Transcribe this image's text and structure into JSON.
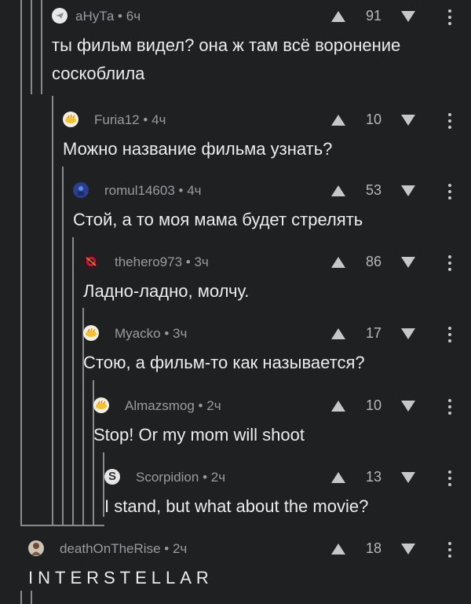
{
  "comments": [
    {
      "author": "аНуТа",
      "time": "6ч",
      "score": "91",
      "text": "ты фильм видел? она ж там всё воронение соскоблила",
      "avatar": "plane-avatar-icon"
    },
    {
      "author": "Furia12",
      "time": "4ч",
      "score": "10",
      "text": "Можно название фильма узнать?",
      "avatar": "lemon-avatar-icon"
    },
    {
      "author": "romul14603",
      "time": "4ч",
      "score": "53",
      "text": "Стой, а то моя мама будет стрелять",
      "avatar": "blue-avatar-icon"
    },
    {
      "author": "thehero973",
      "time": "3ч",
      "score": "86",
      "text": "Ладно-ладно, молчу.",
      "avatar": "red-avatar-icon"
    },
    {
      "author": "Myacko",
      "time": "3ч",
      "score": "17",
      "text": "Стою, а фильм-то как называется?",
      "avatar": "lemon-avatar-icon"
    },
    {
      "author": "Almazsmog",
      "time": "2ч",
      "score": "10",
      "text": "Stop! Or my mom will shoot",
      "avatar": "lemon-avatar-icon"
    },
    {
      "author": "Scorpidion",
      "time": "2ч",
      "score": "13",
      "text": "I stand, but what about the movie?",
      "avatar": "s-letter-avatar-icon"
    },
    {
      "author": "deathOnTheRise",
      "time": "2ч",
      "score": "18",
      "text": "INTERSTELLAR",
      "avatar": "person-avatar-icon"
    }
  ],
  "meta_separator": "•",
  "colors": {
    "background": "#1f2022",
    "thread_line": "#8a8a8a",
    "meta": "#9a9ba0",
    "text": "#ececec"
  }
}
